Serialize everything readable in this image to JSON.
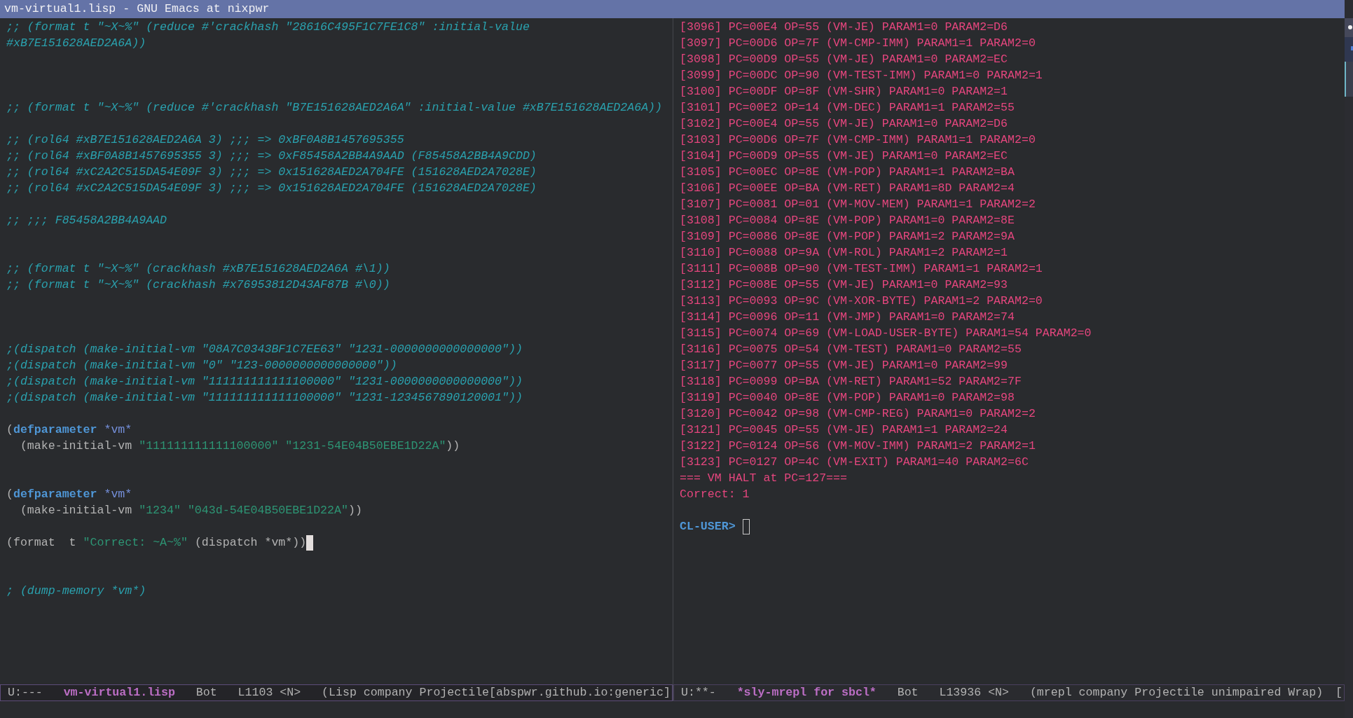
{
  "window": {
    "title": "vm-virtual1.lisp - GNU Emacs at nixpwr"
  },
  "windows": [
    {
      "active": true,
      "lines": [
        {
          "kind": "code",
          "segments": [
            {
              "kind": "comment",
              "text": ";; (format t \"~X~%\" (reduce #'crackhash \"28616C495F1C7FE1C8\" :initial-value"
            }
          ]
        },
        {
          "kind": "code",
          "segments": [
            {
              "kind": "comment",
              "text": "#xB7E151628AED2A6A))"
            }
          ]
        },
        {
          "kind": "blank"
        },
        {
          "kind": "blank"
        },
        {
          "kind": "blank"
        },
        {
          "kind": "code",
          "segments": [
            {
              "kind": "comment",
              "text": ";; (format t \"~X~%\" (reduce #'crackhash \"B7E151628AED2A6A\" :initial-value #xB7E151628AED2A6A))"
            }
          ]
        },
        {
          "kind": "blank"
        },
        {
          "kind": "code",
          "segments": [
            {
              "kind": "comment",
              "text": ";; (rol64 #xB7E151628AED2A6A 3) ;;; => 0xBF0A8B1457695355"
            }
          ]
        },
        {
          "kind": "code",
          "segments": [
            {
              "kind": "comment",
              "text": ";; (rol64 #xBF0A8B1457695355 3) ;;; => 0xF85458A2BB4A9AAD (F85458A2BB4A9CDD)"
            }
          ]
        },
        {
          "kind": "code",
          "segments": [
            {
              "kind": "comment",
              "text": ";; (rol64 #xC2A2C515DA54E09F 3) ;;; => 0x151628AED2A704FE (151628AED2A7028E)"
            }
          ]
        },
        {
          "kind": "code",
          "segments": [
            {
              "kind": "comment",
              "text": ";; (rol64 #xC2A2C515DA54E09F 3) ;;; => 0x151628AED2A704FE (151628AED2A7028E)"
            }
          ]
        },
        {
          "kind": "blank"
        },
        {
          "kind": "code",
          "segments": [
            {
              "kind": "comment",
              "text": ";; ;;; F85458A2BB4A9AAD"
            }
          ]
        },
        {
          "kind": "blank"
        },
        {
          "kind": "blank"
        },
        {
          "kind": "code",
          "segments": [
            {
              "kind": "comment",
              "text": ";; (format t \"~X~%\" (crackhash #xB7E151628AED2A6A #\\1))"
            }
          ]
        },
        {
          "kind": "code",
          "segments": [
            {
              "kind": "comment",
              "text": ";; (format t \"~X~%\" (crackhash #x76953812D43AF87B #\\0))"
            }
          ]
        },
        {
          "kind": "blank"
        },
        {
          "kind": "blank"
        },
        {
          "kind": "blank"
        },
        {
          "kind": "code",
          "segments": [
            {
              "kind": "comment",
              "text": ";(dispatch (make-initial-vm \"08A7C0343BF1C7EE63\" \"1231-0000000000000000\"))"
            }
          ]
        },
        {
          "kind": "code",
          "segments": [
            {
              "kind": "comment",
              "text": ";(dispatch (make-initial-vm \"0\" \"123-0000000000000000\"))"
            }
          ]
        },
        {
          "kind": "code",
          "segments": [
            {
              "kind": "comment",
              "text": ";(dispatch (make-initial-vm \"111111111111100000\" \"1231-0000000000000000\"))"
            }
          ]
        },
        {
          "kind": "code",
          "segments": [
            {
              "kind": "comment",
              "text": ";(dispatch (make-initial-vm \"111111111111100000\" \"1231-1234567890120001\"))"
            }
          ]
        },
        {
          "kind": "blank"
        },
        {
          "kind": "code",
          "segments": [
            {
              "kind": "plain",
              "text": "("
            },
            {
              "kind": "keyword",
              "text": "defparameter"
            },
            {
              "kind": "variable",
              "text": " *vm*"
            }
          ]
        },
        {
          "kind": "code",
          "segments": [
            {
              "kind": "plain",
              "text": "  (make-initial-vm "
            },
            {
              "kind": "string",
              "text": "\"111111111111100000\" \"1231-54E04B50EBE1D22A\""
            },
            {
              "kind": "plain",
              "text": "))"
            }
          ]
        },
        {
          "kind": "blank"
        },
        {
          "kind": "blank"
        },
        {
          "kind": "code",
          "segments": [
            {
              "kind": "plain",
              "text": "("
            },
            {
              "kind": "keyword",
              "text": "defparameter"
            },
            {
              "kind": "variable",
              "text": " *vm*"
            }
          ]
        },
        {
          "kind": "code",
          "segments": [
            {
              "kind": "plain",
              "text": "  (make-initial-vm "
            },
            {
              "kind": "string",
              "text": "\"1234\" \"043d-54E04B50EBE1D22A\""
            },
            {
              "kind": "plain",
              "text": "))"
            }
          ]
        },
        {
          "kind": "blank"
        },
        {
          "kind": "code",
          "segments": [
            {
              "kind": "plain",
              "text": "(format  t "
            },
            {
              "kind": "string",
              "text": "\"Correct: ~A~%\""
            },
            {
              "kind": "plain",
              "text": " (dispatch *vm*))"
            },
            {
              "kind": "cursor"
            }
          ]
        },
        {
          "kind": "blank"
        },
        {
          "kind": "blank"
        },
        {
          "kind": "code",
          "segments": [
            {
              "kind": "comment",
              "text": "; (dump-memory *vm*)"
            }
          ]
        }
      ],
      "mode_line": [
        {
          "kind": "status",
          "text": "U:---"
        },
        {
          "kind": "buffer",
          "text": "vm-virtual1.lisp"
        },
        {
          "kind": "position",
          "text": "Bot"
        },
        {
          "kind": "line",
          "text": "L1103 <N>"
        },
        {
          "kind": "modes",
          "text": "(Lisp company Projectile[abspwr.github.io:generic]"
        }
      ]
    },
    {
      "active": false,
      "lines": [
        {
          "kind": "code",
          "segments": [
            {
              "kind": "output",
              "text": "[3096] PC=00E4 OP=55 (VM-JE) PARAM1=0 PARAM2=D6"
            }
          ]
        },
        {
          "kind": "code",
          "segments": [
            {
              "kind": "output",
              "text": "[3097] PC=00D6 OP=7F (VM-CMP-IMM) PARAM1=1 PARAM2=0"
            }
          ]
        },
        {
          "kind": "code",
          "segments": [
            {
              "kind": "output",
              "text": "[3098] PC=00D9 OP=55 (VM-JE) PARAM1=0 PARAM2=EC"
            }
          ]
        },
        {
          "kind": "code",
          "segments": [
            {
              "kind": "output",
              "text": "[3099] PC=00DC OP=90 (VM-TEST-IMM) PARAM1=0 PARAM2=1"
            }
          ]
        },
        {
          "kind": "code",
          "segments": [
            {
              "kind": "output",
              "text": "[3100] PC=00DF OP=8F (VM-SHR) PARAM1=0 PARAM2=1"
            }
          ]
        },
        {
          "kind": "code",
          "segments": [
            {
              "kind": "output",
              "text": "[3101] PC=00E2 OP=14 (VM-DEC) PARAM1=1 PARAM2=55"
            }
          ]
        },
        {
          "kind": "code",
          "segments": [
            {
              "kind": "output",
              "text": "[3102] PC=00E4 OP=55 (VM-JE) PARAM1=0 PARAM2=D6"
            }
          ]
        },
        {
          "kind": "code",
          "segments": [
            {
              "kind": "output",
              "text": "[3103] PC=00D6 OP=7F (VM-CMP-IMM) PARAM1=1 PARAM2=0"
            }
          ]
        },
        {
          "kind": "code",
          "segments": [
            {
              "kind": "output",
              "text": "[3104] PC=00D9 OP=55 (VM-JE) PARAM1=0 PARAM2=EC"
            }
          ]
        },
        {
          "kind": "code",
          "segments": [
            {
              "kind": "output",
              "text": "[3105] PC=00EC OP=8E (VM-POP) PARAM1=1 PARAM2=BA"
            }
          ]
        },
        {
          "kind": "code",
          "segments": [
            {
              "kind": "output",
              "text": "[3106] PC=00EE OP=BA (VM-RET) PARAM1=8D PARAM2=4"
            }
          ]
        },
        {
          "kind": "code",
          "segments": [
            {
              "kind": "output",
              "text": "[3107] PC=0081 OP=01 (VM-MOV-MEM) PARAM1=1 PARAM2=2"
            }
          ]
        },
        {
          "kind": "code",
          "segments": [
            {
              "kind": "output",
              "text": "[3108] PC=0084 OP=8E (VM-POP) PARAM1=0 PARAM2=8E"
            }
          ]
        },
        {
          "kind": "code",
          "segments": [
            {
              "kind": "output",
              "text": "[3109] PC=0086 OP=8E (VM-POP) PARAM1=2 PARAM2=9A"
            }
          ]
        },
        {
          "kind": "code",
          "segments": [
            {
              "kind": "output",
              "text": "[3110] PC=0088 OP=9A (VM-ROL) PARAM1=2 PARAM2=1"
            }
          ]
        },
        {
          "kind": "code",
          "segments": [
            {
              "kind": "output",
              "text": "[3111] PC=008B OP=90 (VM-TEST-IMM) PARAM1=1 PARAM2=1"
            }
          ]
        },
        {
          "kind": "code",
          "segments": [
            {
              "kind": "output",
              "text": "[3112] PC=008E OP=55 (VM-JE) PARAM1=0 PARAM2=93"
            }
          ]
        },
        {
          "kind": "code",
          "segments": [
            {
              "kind": "output",
              "text": "[3113] PC=0093 OP=9C (VM-XOR-BYTE) PARAM1=2 PARAM2=0"
            }
          ]
        },
        {
          "kind": "code",
          "segments": [
            {
              "kind": "output",
              "text": "[3114] PC=0096 OP=11 (VM-JMP) PARAM1=0 PARAM2=74"
            }
          ]
        },
        {
          "kind": "code",
          "segments": [
            {
              "kind": "output",
              "text": "[3115] PC=0074 OP=69 (VM-LOAD-USER-BYTE) PARAM1=54 PARAM2=0"
            }
          ]
        },
        {
          "kind": "code",
          "segments": [
            {
              "kind": "output",
              "text": "[3116] PC=0075 OP=54 (VM-TEST) PARAM1=0 PARAM2=55"
            }
          ]
        },
        {
          "kind": "code",
          "segments": [
            {
              "kind": "output",
              "text": "[3117] PC=0077 OP=55 (VM-JE) PARAM1=0 PARAM2=99"
            }
          ]
        },
        {
          "kind": "code",
          "segments": [
            {
              "kind": "output",
              "text": "[3118] PC=0099 OP=BA (VM-RET) PARAM1=52 PARAM2=7F"
            }
          ]
        },
        {
          "kind": "code",
          "segments": [
            {
              "kind": "output",
              "text": "[3119] PC=0040 OP=8E (VM-POP) PARAM1=0 PARAM2=98"
            }
          ]
        },
        {
          "kind": "code",
          "segments": [
            {
              "kind": "output",
              "text": "[3120] PC=0042 OP=98 (VM-CMP-REG) PARAM1=0 PARAM2=2"
            }
          ]
        },
        {
          "kind": "code",
          "segments": [
            {
              "kind": "output",
              "text": "[3121] PC=0045 OP=55 (VM-JE) PARAM1=1 PARAM2=24"
            }
          ]
        },
        {
          "kind": "code",
          "segments": [
            {
              "kind": "output",
              "text": "[3122] PC=0124 OP=56 (VM-MOV-IMM) PARAM1=2 PARAM2=1"
            }
          ]
        },
        {
          "kind": "code",
          "segments": [
            {
              "kind": "output",
              "text": "[3123] PC=0127 OP=4C (VM-EXIT) PARAM1=40 PARAM2=6C"
            }
          ]
        },
        {
          "kind": "code",
          "segments": [
            {
              "kind": "output",
              "text": "=== VM HALT at PC=127==="
            }
          ]
        },
        {
          "kind": "code",
          "segments": [
            {
              "kind": "output",
              "text": "Correct: 1"
            }
          ]
        },
        {
          "kind": "blank"
        },
        {
          "kind": "code",
          "segments": [
            {
              "kind": "prompt",
              "text": "CL-USER>"
            },
            {
              "kind": "cursor"
            }
          ]
        }
      ],
      "mode_line": [
        {
          "kind": "status",
          "text": "U:**-"
        },
        {
          "kind": "buffer",
          "text": "*sly-mrepl for sbcl*"
        },
        {
          "kind": "position",
          "text": "Bot"
        },
        {
          "kind": "line",
          "text": "L13936 <N>"
        },
        {
          "kind": "modes",
          "text": "(mrepl company Projectile unimpaired Wrap)"
        },
        {
          "kind": "overflow",
          "text": "["
        }
      ]
    }
  ]
}
